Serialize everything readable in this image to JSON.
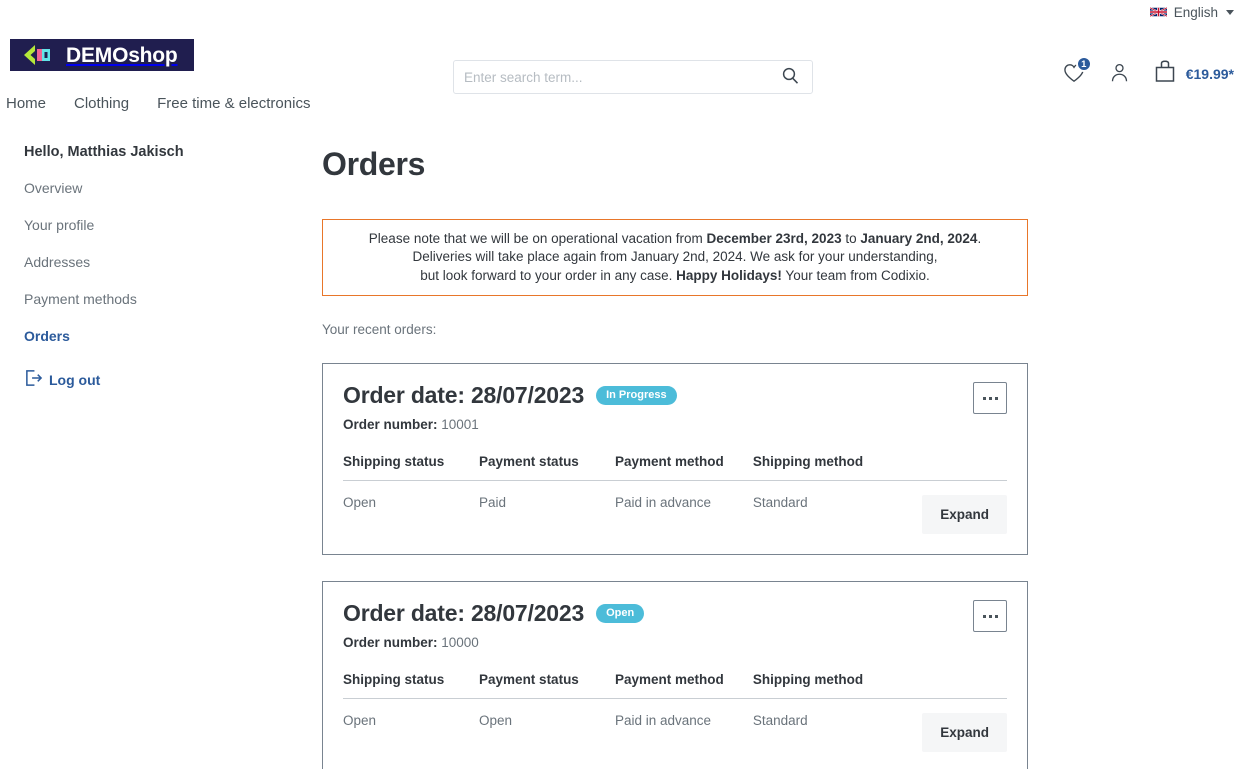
{
  "topbar": {
    "language_label": "English",
    "flag_icon": "uk-flag-icon",
    "caret_icon": "chevron-down-icon"
  },
  "header": {
    "logo_text": "DEMOshop",
    "logo_brand_dark": "#201e4f",
    "logo_chevron_color": "#b5e83a",
    "logo_accent_color": "#62e3e8",
    "search": {
      "placeholder": "Enter search term...",
      "value": "",
      "icon": "search-icon"
    },
    "wishlist": {
      "icon": "heart-icon",
      "badge_count": "1"
    },
    "account": {
      "icon": "user-icon"
    },
    "cart": {
      "icon": "shopping-bag-icon",
      "total": "€19.99*"
    }
  },
  "mainnav": {
    "items": [
      {
        "label": "Home"
      },
      {
        "label": "Clothing"
      },
      {
        "label": "Free time & electronics"
      }
    ]
  },
  "sidebar": {
    "greeting": "Hello, Matthias Jakisch",
    "items": [
      {
        "label": "Overview",
        "active": false
      },
      {
        "label": "Your profile",
        "active": false
      },
      {
        "label": "Addresses",
        "active": false
      },
      {
        "label": "Payment methods",
        "active": false
      },
      {
        "label": "Orders",
        "active": true
      }
    ],
    "logout": {
      "label": "Log out",
      "icon": "logout-icon"
    }
  },
  "main": {
    "title": "Orders",
    "notice": {
      "border_color": "#e8762a",
      "line1_a": "Please note that we will be on operational vacation from ",
      "line1_b": "December 23rd, 2023",
      "line1_c": " to ",
      "line1_d": "January 2nd, 2024",
      "line1_e": ".",
      "line2": "Deliveries will take place again from January 2nd, 2024. We ask for your understanding,",
      "line3_a": "but look forward to your order in any case. ",
      "line3_b": "Happy Holidays!",
      "line3_c": " Your team from Codixio."
    },
    "recent_orders_label": "Your recent orders:",
    "table_headers": [
      "Shipping status",
      "Payment status",
      "Payment method",
      "Shipping method"
    ],
    "expand_label": "Expand",
    "menu_icon": "ellipsis-icon",
    "order_date_prefix": "Order date: ",
    "order_number_prefix": "Order number: ",
    "status_badge_color": "#4cbcd9",
    "orders": [
      {
        "date": "28/07/2023",
        "status": "In Progress",
        "number": "10001",
        "shipping_status": "Open",
        "payment_status": "Paid",
        "payment_method": "Paid in advance",
        "shipping_method": "Standard"
      },
      {
        "date": "28/07/2023",
        "status": "Open",
        "number": "10000",
        "shipping_status": "Open",
        "payment_status": "Open",
        "payment_method": "Paid in advance",
        "shipping_method": "Standard"
      }
    ]
  }
}
